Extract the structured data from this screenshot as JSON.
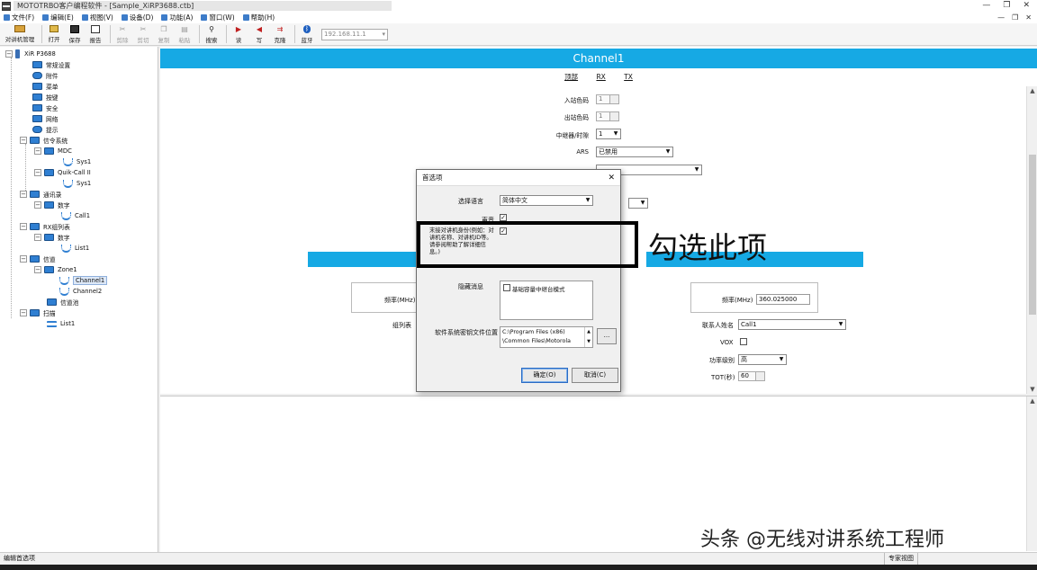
{
  "window": {
    "title": "MOTOTRBO客户编程软件 - [Sample_XiRP3688.ctb]",
    "buttons": [
      "—",
      "❐",
      "✕"
    ],
    "mdi_buttons": [
      "—",
      "❐",
      "✕"
    ]
  },
  "menu": [
    {
      "label": "文件(F)"
    },
    {
      "label": "编辑(E)"
    },
    {
      "label": "视图(V)"
    },
    {
      "label": "设备(D)"
    },
    {
      "label": "功能(A)"
    },
    {
      "label": "窗口(W)"
    },
    {
      "label": "帮助(H)"
    }
  ],
  "toolbar": {
    "buttons": [
      {
        "label": "对讲机管理",
        "icon": "radio-manage-icon",
        "enabled": true
      },
      {
        "label": "打开",
        "icon": "folder-open-icon",
        "enabled": true
      },
      {
        "label": "保存",
        "icon": "floppy-icon",
        "enabled": true
      },
      {
        "label": "报告",
        "icon": "report-icon",
        "enabled": true
      },
      {
        "label": "剪除",
        "icon": "scissors-icon",
        "enabled": false
      },
      {
        "label": "剪切",
        "icon": "cut-icon",
        "enabled": false
      },
      {
        "label": "复制",
        "icon": "copy-icon",
        "enabled": false
      },
      {
        "label": "粘贴",
        "icon": "paste-icon",
        "enabled": false
      },
      {
        "label": "搜索",
        "icon": "search-icon",
        "enabled": true
      },
      {
        "label": "读",
        "icon": "read-icon",
        "enabled": true
      },
      {
        "label": "写",
        "icon": "write-icon",
        "enabled": true
      },
      {
        "label": "克隆",
        "icon": "clone-icon",
        "enabled": true
      },
      {
        "label": "蓝牙",
        "icon": "bluetooth-icon",
        "enabled": true
      }
    ],
    "ip_value": "192.168.11.1"
  },
  "tree": {
    "root": "XiR P3688",
    "items": {
      "general": "常规设置",
      "accessory": "附件",
      "menu": "菜单",
      "display": "按键",
      "security": "安全",
      "network": "网络",
      "tone": "提示",
      "signaling": "信令系统",
      "mdc": "MDC",
      "mdc_sys": "Sys1",
      "quickcall": "Quik-Call II",
      "quickcall_sys": "Sys1",
      "contacts": "通讯录",
      "digital": "数字",
      "call1": "Call1",
      "rxgroup": "RX组列表",
      "rx_digital": "数字",
      "list1": "List1",
      "channels": "信道",
      "zone1": "Zone1",
      "channel1": "Channel1",
      "channel2": "Channel2",
      "channel_pool": "信道池",
      "scan": "扫描",
      "scan_list1": "List1"
    }
  },
  "channel": {
    "header": "Channel1",
    "tabs": [
      "顶部",
      "RX",
      "TX"
    ],
    "fields": {
      "in_color": "入站色码",
      "in_color_val": "1",
      "out_color": "出站色码",
      "out_color_val": "1",
      "slot": "中继器/时隙",
      "slot_val": "1",
      "ars": "ARS",
      "ars_val": "已禁用",
      "rx_freq_label": "频率(MHz)",
      "group_list": "组列表",
      "tx_freq_label": "频率(MHz)",
      "tx_freq_val": "360.025000",
      "contact_name": "联系人姓名",
      "contact_val": "Call1",
      "vox": "VOX",
      "power": "功率级别",
      "power_val": "高",
      "tot": "TOT(秒)",
      "tot_val": "60"
    }
  },
  "dialog": {
    "title": "首选项",
    "close": "✕",
    "language_label": "选择语言",
    "language_val": "简体中文",
    "sound_label": "声音",
    "identity_label": "末接对讲机身份(例如：对讲机名称、对讲机ID等。请参阅帮助了解详细信息。)",
    "hidden_label": "隐藏消息",
    "hidden_option": "基础容量中继台模式",
    "keyfile_label": "软件系统密钥文件位置",
    "keyfile_path_1": "C:\\Program Files (x86)",
    "keyfile_path_2": "\\Common Files\\Motorola",
    "browse": "...",
    "ok": "确定(O)",
    "cancel": "取消(C)"
  },
  "annotation": "勾选此项",
  "watermark": "头条 @无线对讲系统工程师",
  "status": {
    "left": "编辑首选项",
    "right": "专家视图"
  },
  "colors": {
    "accent": "#16a9e4",
    "highlight_border": "#000000"
  }
}
